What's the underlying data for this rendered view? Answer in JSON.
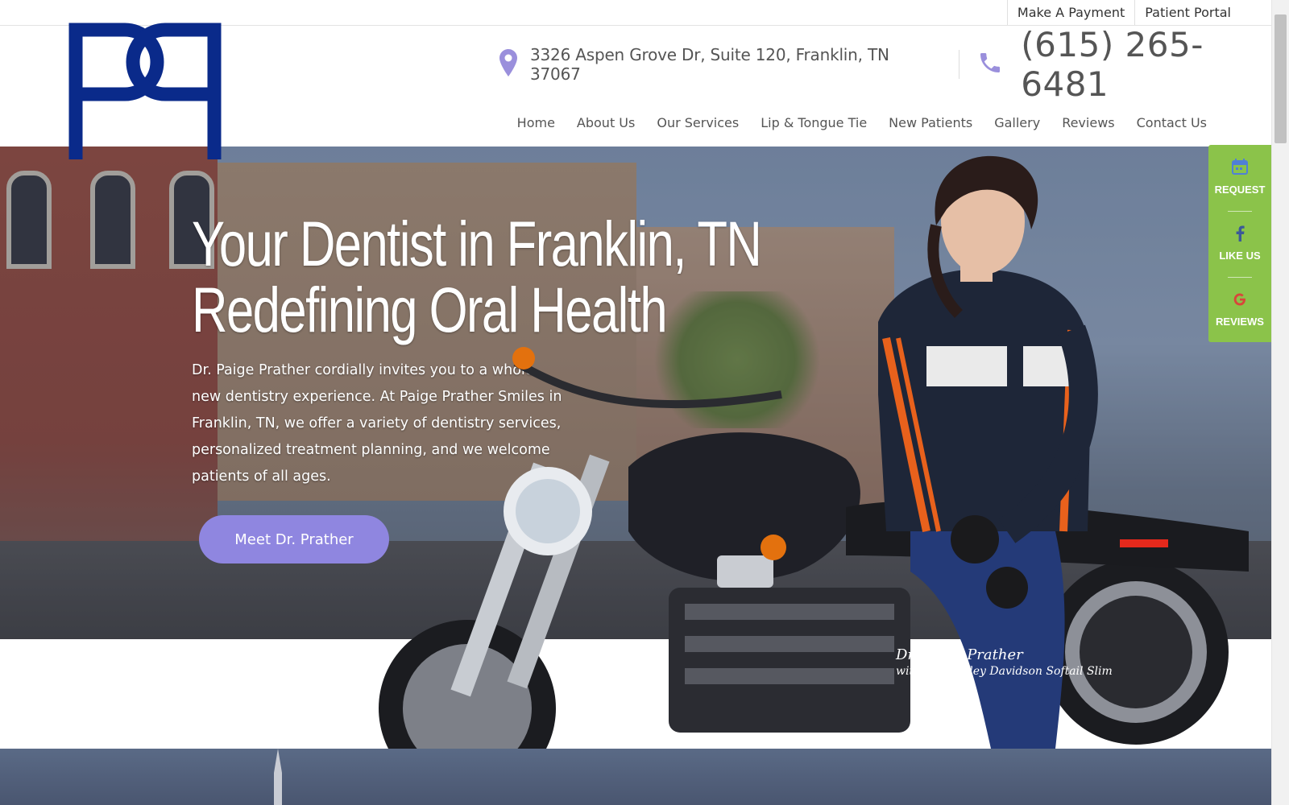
{
  "topbar": {
    "links": [
      {
        "label": "Make A Payment"
      },
      {
        "label": "Patient Portal"
      }
    ]
  },
  "header": {
    "address": "3326 Aspen Grove Dr, Suite 120, Franklin, TN 37067",
    "phone": "(615) 265-6481",
    "brand_color": "#0a2a8a"
  },
  "nav": {
    "items": [
      {
        "label": "Home"
      },
      {
        "label": "About Us"
      },
      {
        "label": "Our Services"
      },
      {
        "label": "Lip & Tongue Tie"
      },
      {
        "label": "New Patients"
      },
      {
        "label": "Gallery"
      },
      {
        "label": "Reviews"
      },
      {
        "label": "Contact Us"
      }
    ]
  },
  "hero": {
    "title_line1": "Your Dentist in Franklin, TN",
    "title_line2": "Redefining Oral Health",
    "text": "Dr. Paige Prather cordially invites you to a whole new dentistry experience. At Paige Prather Smiles in Franklin, TN, we offer a variety of dentistry services, personalized treatment planning, and we welcome patients of all ages.",
    "button_label": "Meet Dr. Prather",
    "button_color": "#8f86e0",
    "caption_name": "Dr. Paige Prather",
    "caption_sub": "with her Harley Davidson Softail Slim"
  },
  "side_widget": {
    "color": "#8bc34a",
    "items": [
      {
        "label": "REQUEST",
        "icon": "calendar-icon"
      },
      {
        "label": "LIKE US",
        "icon": "facebook-icon"
      },
      {
        "label": "REVIEWS",
        "icon": "google-icon"
      }
    ]
  }
}
